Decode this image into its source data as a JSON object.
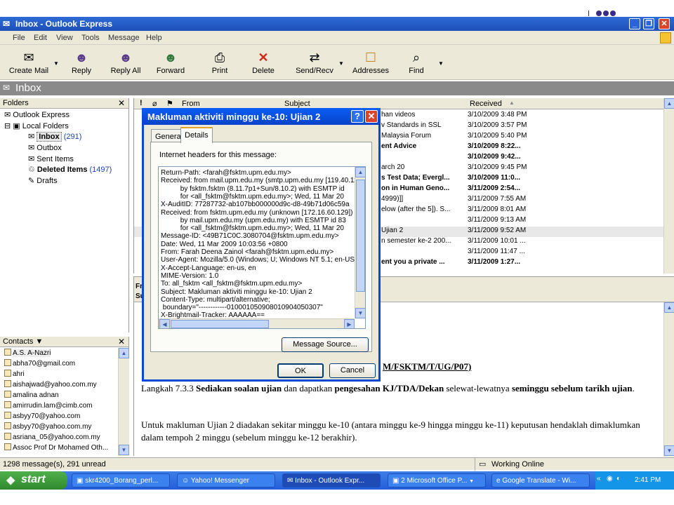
{
  "window": {
    "title": "Inbox - Outlook Express"
  },
  "menu": [
    "File",
    "Edit",
    "View",
    "Tools",
    "Message",
    "Help"
  ],
  "toolbar": {
    "create": "Create Mail",
    "reply": "Reply",
    "reply_all": "Reply All",
    "forward": "Forward",
    "print": "Print",
    "delete": "Delete",
    "sendrecv": "Send/Recv",
    "addresses": "Addresses",
    "find": "Find"
  },
  "banner": "Inbox",
  "folders": {
    "header": "Folders",
    "items": [
      {
        "label": "Outlook Express",
        "count": ""
      },
      {
        "label": "Local Folders",
        "count": ""
      },
      {
        "label": "Inbox",
        "count": "(291)"
      },
      {
        "label": "Outbox",
        "count": ""
      },
      {
        "label": "Sent Items",
        "count": ""
      },
      {
        "label": "Deleted Items",
        "count": "(1497)"
      },
      {
        "label": "Drafts",
        "count": ""
      }
    ]
  },
  "contacts": {
    "header": "Contacts ▼",
    "items": [
      "A.S. A-Nazri",
      "abha70@gmail.com",
      "ahri",
      "aishajwad@yahoo.com.my",
      "amalina adnan",
      "amirrudin.lam@cimb.com",
      "asbyy70@yahoo.com",
      "asbyy70@yahoo.com.my",
      "asriana_05@yahoo.com.my",
      "Assoc Prof Dr Mohamed Oth..."
    ]
  },
  "list": {
    "col_from": "From",
    "col_subject": "Subject",
    "col_received": "Received",
    "rows": [
      {
        "subject": "han videos",
        "date": "3/10/2009 3:48 PM",
        "bold": false
      },
      {
        "subject": "v Standards in SSL",
        "date": "3/10/2009 3:57 PM",
        "bold": false
      },
      {
        "subject": "Malaysia Forum",
        "date": "3/10/2009 5:40 PM",
        "bold": false
      },
      {
        "subject": "ent Advice",
        "date": "3/10/2009 8:22...",
        "bold": true
      },
      {
        "subject": "",
        "date": "3/10/2009 9:42...",
        "bold": true
      },
      {
        "subject": "arch 20",
        "date": "3/10/2009 9:45 PM",
        "bold": false
      },
      {
        "subject": "s Test Data; Evergl...",
        "date": "3/10/2009 11:0...",
        "bold": true
      },
      {
        "subject": "on in Human Geno...",
        "date": "3/11/2009 2:54...",
        "bold": true
      },
      {
        "subject": "4999)]]",
        "date": "3/11/2009 7:55 AM",
        "bold": false
      },
      {
        "subject": "elow (after the 5]). S...",
        "date": "3/11/2009 8:01 AM",
        "bold": false
      },
      {
        "subject": "",
        "date": "3/11/2009 9:13 AM",
        "bold": false
      },
      {
        "subject": "Ujian 2",
        "date": "3/11/2009 9:52 AM",
        "bold": false
      },
      {
        "subject": "n semester ke-2 200...",
        "date": "3/11/2009 10:01 ...",
        "bold": false
      },
      {
        "subject": "",
        "date": "3/11/2009 11:47 ...",
        "bold": false
      },
      {
        "subject": "ent you a private ...",
        "date": "3/11/2009 1:27...",
        "bold": true
      }
    ]
  },
  "preview": {
    "from_label": "Fr",
    "subject_label": "Su",
    "ref_fragment": "M/FSKTM/T/UG/P07)",
    "para1_a": "Langkah 7.3.3 ",
    "para1_b": "Sediakan soalan ujian",
    "para1_c": " dan dapatkan ",
    "para1_d": "pengesahan KJ/TDA/Dekan",
    "para1_e": " selewat-lewatnya ",
    "para1_f": "seminggu sebelum tarikh ujian",
    "para1_g": ".",
    "para2": "Untuk makluman Ujian 2 diadakan sekitar minggu ke-10 (antara minggu ke-9 hingga minggu ke-11) keputusan hendaklah dimaklumkan dalam tempoh 2 minggu (sebelum minggu ke-12 berakhir)."
  },
  "dialog": {
    "title": "Makluman aktiviti minggu ke-10: Ujian 2",
    "tab_general": "General",
    "tab_details": "Details",
    "label": "Internet headers for this message:",
    "headers": [
      "Return-Path: <farah@fsktm.upm.edu.my>",
      "Received: from mail.upm.edu.my (smtp.upm.edu.my [119.40.11",
      "          by fsktm.fsktm (8.11.7p1+Sun/8.10.2) with ESMTP id",
      "          for <all_fsktm@fsktm.upm.edu.my>; Wed, 11 Mar 20",
      "X-AuditID: 77287732-ab107bb000000d9c-d8-49b71d06c59a",
      "Received: from fsktm.upm.edu.my (unknown [172.16.60.129])",
      "          by mail.upm.edu.my (upm.edu.my) with ESMTP id 83",
      "          for <all_fsktm@fsktm.upm.edu.my>; Wed, 11 Mar 20",
      "Message-ID: <49B71C0C.3080704@fsktm.upm.edu.my>",
      "Date: Wed, 11 Mar 2009 10:03:56 +0800",
      "From: Farah Deena Zainol <farah@fsktm.upm.edu.my>",
      "User-Agent: Mozilla/5.0 (Windows; U; Windows NT 5.1; en-US",
      "X-Accept-Language: en-us, en",
      "MIME-Version: 1.0",
      "To: all_fsktm <all_fsktm@fsktm.upm.edu.my>",
      "Subject: Makluman aktiviti minggu ke-10: Ujian 2",
      "Content-Type: multipart/alternative;",
      " boundary=\"------------010001050908010904050307\"",
      "X-Brightmail-Tracker: AAAAAA=="
    ],
    "msg_source": "Message Source...",
    "ok": "OK",
    "cancel": "Cancel"
  },
  "status": {
    "messages": "1298 message(s), 291 unread",
    "online": "Working Online"
  },
  "taskbar": {
    "start": "start",
    "tasks": [
      "skr4200_Borang_perl...",
      "Yahoo! Messenger",
      "Inbox - Outlook Expr...",
      "2 Microsoft Office P...",
      "Google Translate - Wi..."
    ],
    "clock": "2:41 PM"
  }
}
